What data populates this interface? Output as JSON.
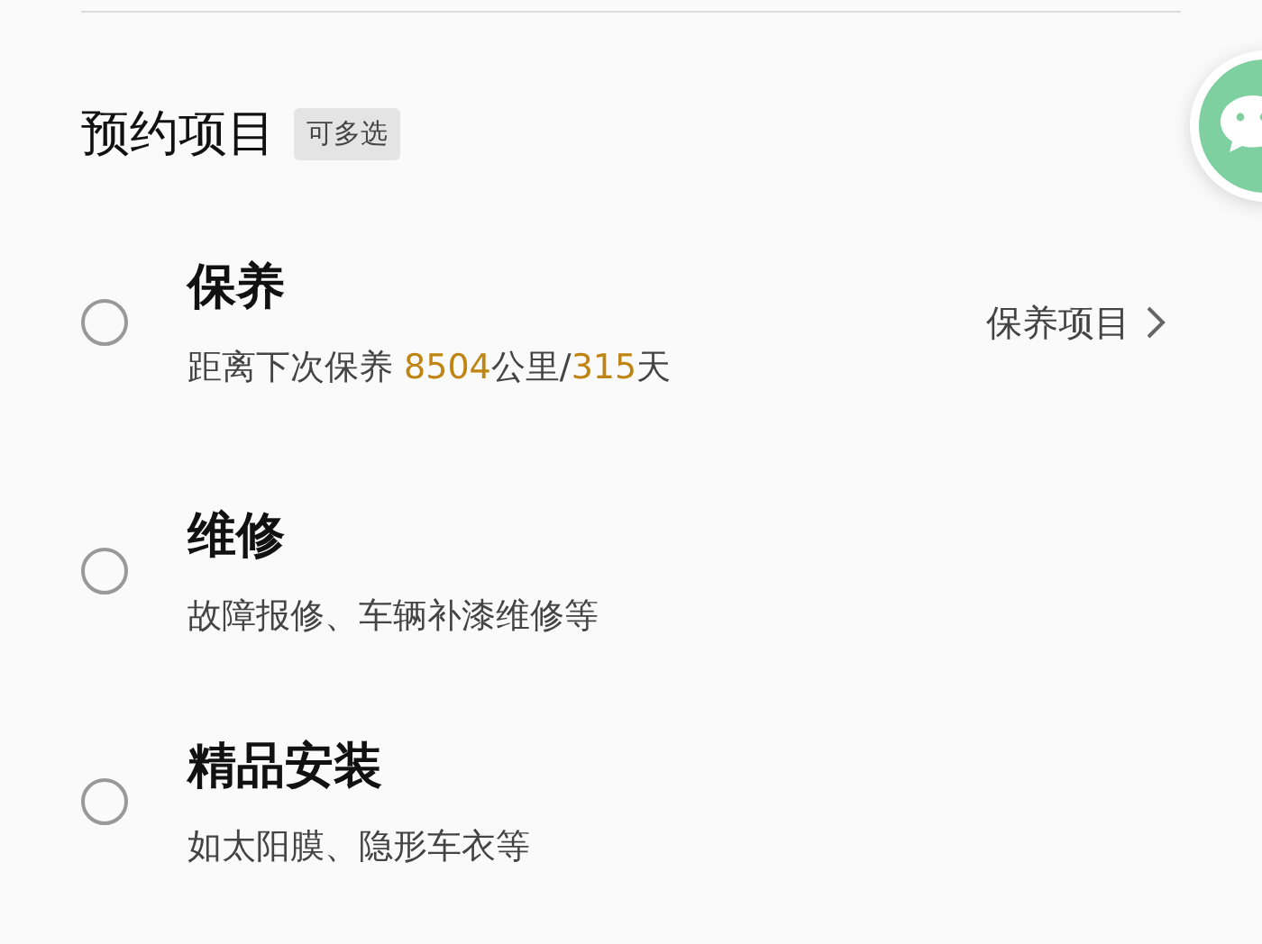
{
  "section": {
    "title": "预约项目",
    "badge": "可多选"
  },
  "items": [
    {
      "title": "保养",
      "selected": false,
      "subtitle": [
        {
          "text": "距离下次保养 ",
          "highlight": false
        },
        {
          "text": "8504",
          "highlight": true
        },
        {
          "text": "公里/",
          "highlight": false
        },
        {
          "text": "315",
          "highlight": true
        },
        {
          "text": "天",
          "highlight": false
        }
      ],
      "link": "保养项目"
    },
    {
      "title": "维修",
      "selected": false,
      "subtitle": [
        {
          "text": "故障报修、车辆补漆维修等",
          "highlight": false
        }
      ]
    },
    {
      "title": "精品安装",
      "selected": false,
      "subtitle": [
        {
          "text": "如太阳膜、隐形车衣等",
          "highlight": false
        }
      ]
    }
  ]
}
